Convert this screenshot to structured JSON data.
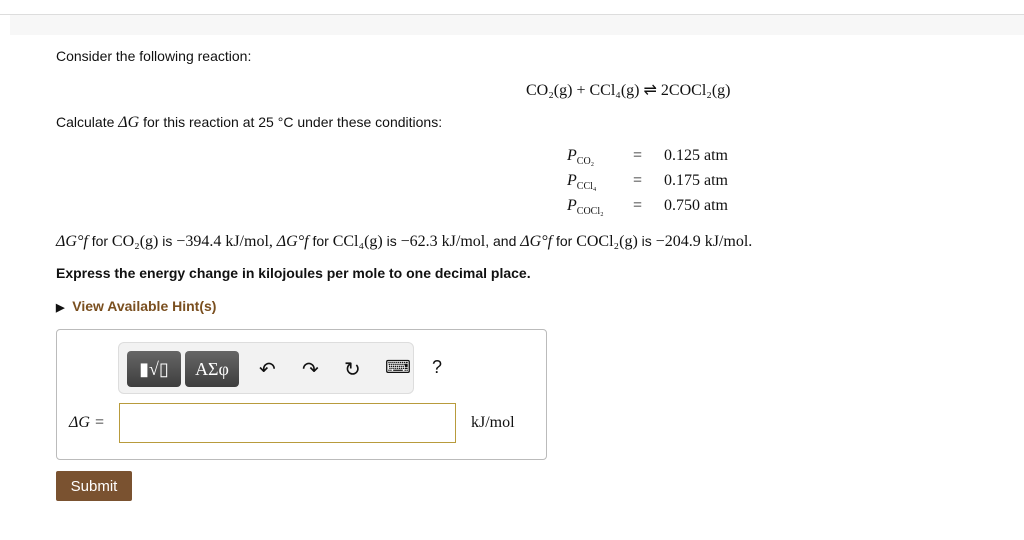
{
  "intro": "Consider the following reaction:",
  "reaction": {
    "left": "CO₂(g) + CCl₄(g)",
    "arrow": "⇌",
    "right": "2COCl₂(g)"
  },
  "calc": {
    "pre": "Calculate",
    "sym": "ΔG",
    "post": "for this reaction at 25 °C under these conditions:"
  },
  "pressures": [
    {
      "label": "P",
      "sub": "CO₂",
      "value": "0.125 atm"
    },
    {
      "label": "P",
      "sub": "CCl₄",
      "value": "0.175 atm"
    },
    {
      "label": "P",
      "sub": "COCl₂",
      "value": "0.750 atm"
    }
  ],
  "dgf": {
    "a": "ΔG°f",
    "for": "for",
    "is": "is",
    "and": ", and",
    "co2": "CO₂(g)",
    "co2v": "−394.4 kJ/mol,",
    "ccl4": "CCl₄(g)",
    "ccl4v": "−62.3 kJ/mol",
    "cocl2": "COCl₂(g)",
    "cocl2v": "−204.9 kJ/mol."
  },
  "instruction": "Express the energy change in kilojoules per mole to one decimal place.",
  "hint": "View Available Hint(s)",
  "toolbar": {
    "greek": "ΑΣφ",
    "help": "?"
  },
  "answer": {
    "label": "ΔG =",
    "value": "",
    "unit": "kJ/mol"
  },
  "submit": "Submit"
}
